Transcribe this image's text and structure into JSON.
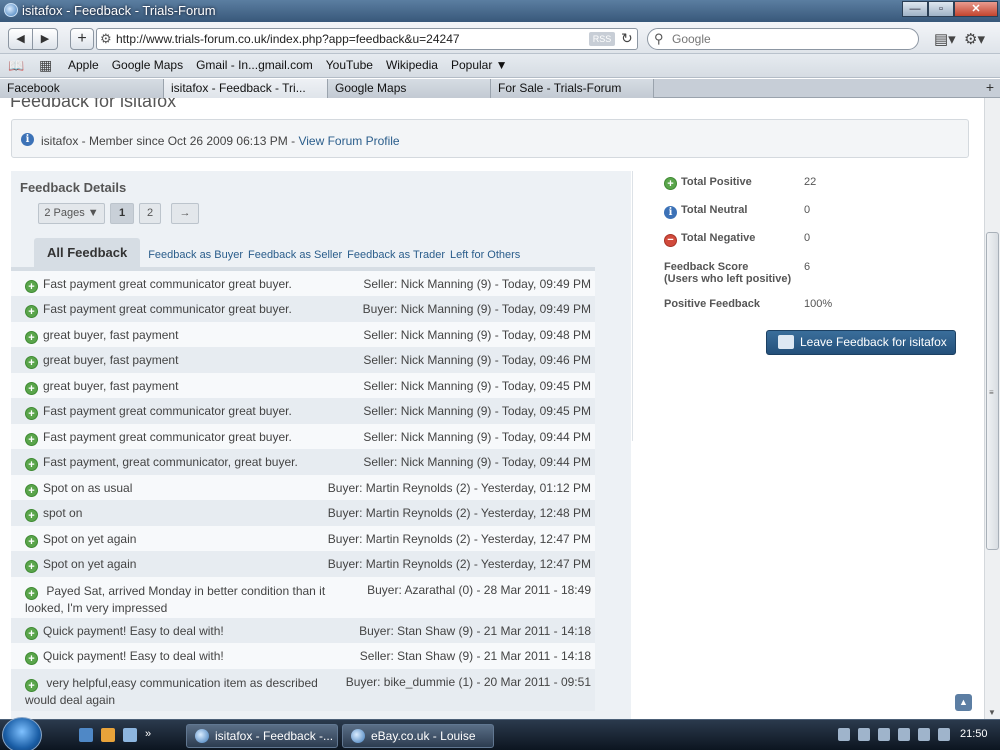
{
  "window": {
    "title": "isitafox - Feedback - Trials-Forum"
  },
  "toolbar": {
    "url": "http://www.trials-forum.co.uk/index.php?app=feedback&u=24247",
    "rss_label": "RSS",
    "search_placeholder": "Google"
  },
  "bookmarks": [
    "Apple",
    "Google Maps",
    "Gmail - In...gmail.com",
    "YouTube",
    "Wikipedia",
    "Popular ▼"
  ],
  "tabs": [
    "Facebook",
    "isitafox - Feedback - Tri...",
    "Google Maps",
    "For Sale - Trials-Forum"
  ],
  "page": {
    "title": "Feedback for isitafox",
    "member_line": "isitafox - Member since Oct 26 2009 06:13 PM - ",
    "profile_link": "View Forum Profile",
    "section_title": "Feedback Details",
    "pages_label": "2 Pages ▼",
    "page_1": "1",
    "page_2": "2",
    "next_label": "→",
    "filter_tabs": [
      "All Feedback",
      "Feedback as Buyer",
      "Feedback as Seller",
      "Feedback as Trader",
      "Left for Others"
    ]
  },
  "feedback": [
    {
      "comment": "Fast payment great communicator great buyer.",
      "who": "Seller: Nick Manning (9) - Today, 09:49 PM"
    },
    {
      "comment": "Fast payment great communicator great buyer.",
      "who": "Buyer: Nick Manning (9) - Today, 09:49 PM"
    },
    {
      "comment": "great buyer, fast payment",
      "who": "Seller: Nick Manning (9) - Today, 09:48 PM"
    },
    {
      "comment": "great buyer, fast payment",
      "who": "Seller: Nick Manning (9) - Today, 09:46 PM"
    },
    {
      "comment": "great buyer, fast payment",
      "who": "Seller: Nick Manning (9) - Today, 09:45 PM"
    },
    {
      "comment": "Fast payment great communicator great buyer.",
      "who": "Seller: Nick Manning (9) - Today, 09:45 PM"
    },
    {
      "comment": "Fast payment great communicator great buyer.",
      "who": "Seller: Nick Manning (9) - Today, 09:44 PM"
    },
    {
      "comment": "Fast payment, great communicator, great buyer.",
      "who": "Seller: Nick Manning (9) - Today, 09:44 PM"
    },
    {
      "comment": "Spot on as usual",
      "who": "Buyer: Martin Reynolds (2) - Yesterday, 01:12 PM"
    },
    {
      "comment": "spot on",
      "who": "Buyer: Martin Reynolds (2) - Yesterday, 12:48 PM"
    },
    {
      "comment": "Spot on yet again",
      "who": "Buyer: Martin Reynolds (2) - Yesterday, 12:47 PM"
    },
    {
      "comment": "Spot on yet again",
      "who": "Buyer: Martin Reynolds (2) - Yesterday, 12:47 PM"
    },
    {
      "comment": "Payed Sat, arrived Monday in better condition than it looked, I'm very impressed",
      "who": "Buyer: Azarathal (0) - 28 Mar 2011 - 18:49"
    },
    {
      "comment": "Quick payment! Easy to deal with!",
      "who": "Buyer: Stan Shaw (9) - 21 Mar 2011 - 14:18"
    },
    {
      "comment": "Quick payment! Easy to deal with!",
      "who": "Seller: Stan Shaw (9) - 21 Mar 2011 - 14:18"
    },
    {
      "comment": "very helpful,easy communication item as described would deal again",
      "who": "Buyer: bike_dummie (1) - 20 Mar 2011 - 09:51"
    }
  ],
  "stats": {
    "total_positive_label": "Total Positive",
    "total_positive": "22",
    "total_neutral_label": "Total Neutral",
    "total_neutral": "0",
    "total_negative_label": "Total Negative",
    "total_negative": "0",
    "score_label": "Feedback Score",
    "score_sublabel": "(Users who left positive)",
    "score": "6",
    "positive_pct_label": "Positive Feedback",
    "positive_pct": "100%",
    "leave_button": "Leave Feedback for isitafox"
  },
  "taskbar": {
    "tasks": [
      "isitafox - Feedback -...",
      "eBay.co.uk - Louise"
    ],
    "clock": "21:50"
  }
}
